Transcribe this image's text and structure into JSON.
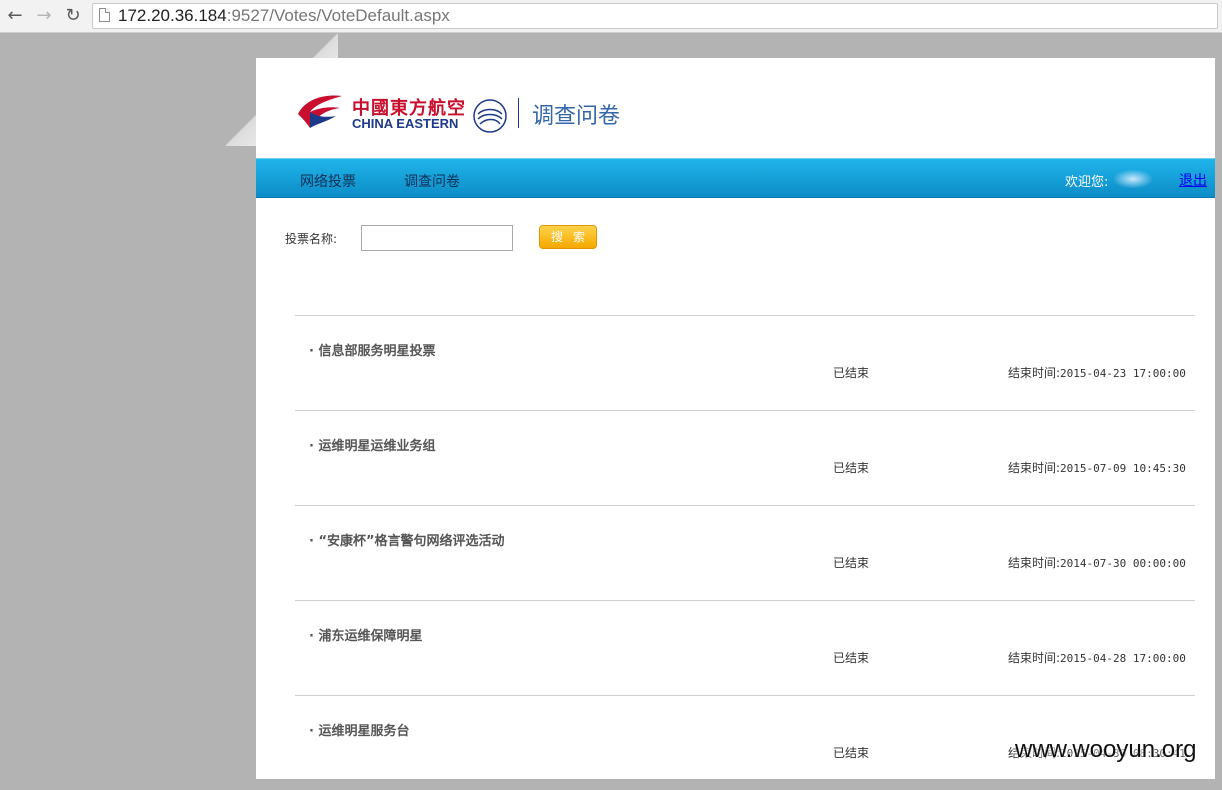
{
  "browser": {
    "url_host": "172.20.36.184",
    "url_rest": ":9527/Votes/VoteDefault.aspx"
  },
  "header": {
    "logo_cn": "中國東方航空",
    "logo_en": "CHINA EASTERN",
    "section_title": "调查问卷"
  },
  "nav": {
    "items": [
      {
        "label": "网络投票"
      },
      {
        "label": "调查问卷"
      }
    ],
    "welcome": "欢迎您:",
    "logout": "退出"
  },
  "search": {
    "label": "投票名称:",
    "value": "",
    "button": "搜索"
  },
  "votes": [
    {
      "title": "· 信息部服务明星投票",
      "status": "已结束",
      "end_label": "结束时间:",
      "end_time": "2015-04-23 17:00:00"
    },
    {
      "title": "· 运维明星运维业务组",
      "status": "已结束",
      "end_label": "结束时间:",
      "end_time": "2015-07-09 10:45:30"
    },
    {
      "title": "· “安康杯”格言警句网络评选活动",
      "status": "已结束",
      "end_label": "结束时间:",
      "end_time": "2014-07-30 00:00:00"
    },
    {
      "title": "· 浦东运维保障明星",
      "status": "已结束",
      "end_label": "结束时间:",
      "end_time": "2015-04-28 17:00:00"
    },
    {
      "title": "· 运维明星服务台",
      "status": "已结束",
      "end_label": "结束时间:",
      "end_time": "2015-04-30 08:30:41"
    }
  ],
  "watermark": "www.wooyun.org",
  "colors": {
    "nav_blue": "#1aa8e0",
    "brand_red": "#c8102e",
    "brand_navy": "#1d3a8a",
    "search_button": "#f7b500"
  }
}
